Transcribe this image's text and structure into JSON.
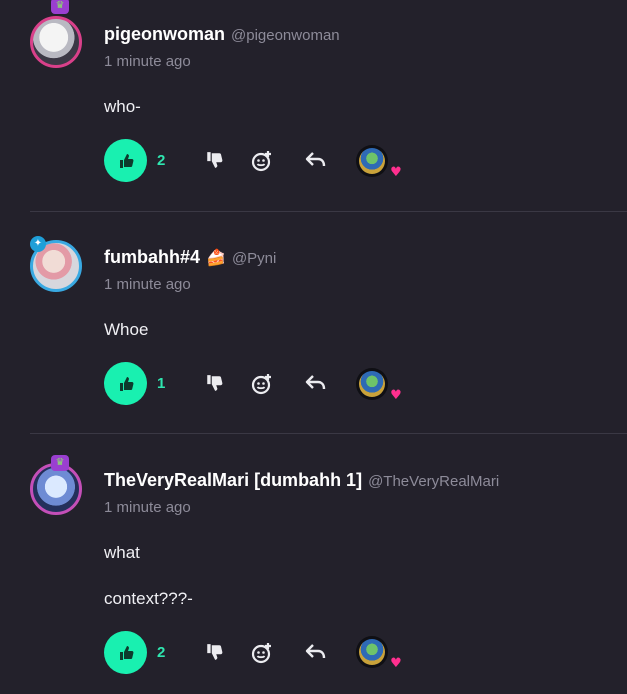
{
  "posts": [
    {
      "display_name": "pigeonwoman",
      "handle": "@pigeonwoman",
      "time": "1 minute ago",
      "lines": [
        "who-"
      ],
      "likes": "2"
    },
    {
      "display_name": "fumbahh#4",
      "name_emoji": "🍰",
      "handle": "@Pyni",
      "time": "1 minute ago",
      "lines": [
        "Whoe"
      ],
      "likes": "1"
    },
    {
      "display_name": "TheVeryRealMari [dumbahh 1]",
      "handle": "@TheVeryRealMari",
      "time": "1 minute ago",
      "lines": [
        "what",
        "context???-"
      ],
      "likes": "2"
    }
  ],
  "colors": {
    "background": "#23212b",
    "like_accent": "#19f0b0",
    "heart": "#ff2f8f"
  },
  "icons": {
    "like": "thumbs-up-icon",
    "dislike": "thumbs-down-icon",
    "react": "add-emoji-icon",
    "reply": "reply-arrow-icon",
    "reaction": "heart-icon"
  }
}
